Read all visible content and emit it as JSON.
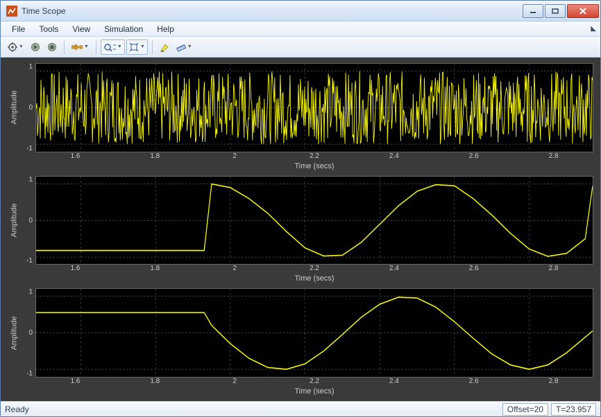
{
  "window": {
    "title": "Time Scope"
  },
  "menu": {
    "items": [
      "File",
      "Tools",
      "View",
      "Simulation",
      "Help"
    ]
  },
  "toolbar": {
    "icons": [
      "gear-icon",
      "play-icon",
      "stop-icon",
      "step-icon",
      "zoom-icon",
      "fit-icon",
      "highlight-icon",
      "measure-icon"
    ]
  },
  "status": {
    "ready": "Ready",
    "offset": "Offset=20",
    "time": "T=23.957"
  },
  "axes": {
    "x_ticks": [
      "1.6",
      "1.8",
      "2",
      "2.2",
      "2.4",
      "2.6",
      "2.8"
    ],
    "y_ticks": [
      "1",
      "0",
      "-1"
    ],
    "xlabel": "Time (secs)",
    "ylabel": "Amplitude"
  },
  "chart_data": [
    {
      "type": "line",
      "title": "",
      "ylabel": "Amplitude",
      "xlabel": "Time (secs)",
      "xlim": [
        1.48,
        2.97
      ],
      "ylim": [
        -1.2,
        1.2
      ],
      "description": "yellow random noise filling full amplitude range (-1..1) across entire visible time window",
      "series": [
        {
          "name": "noise",
          "note": "dense random samples uniform in [-1,1]"
        }
      ]
    },
    {
      "type": "line",
      "title": "",
      "ylabel": "Amplitude",
      "xlabel": "Time (secs)",
      "xlim": [
        1.48,
        2.97
      ],
      "ylim": [
        -1.2,
        1.2
      ],
      "series": [
        {
          "name": "cos-start-1.93",
          "x": [
            1.48,
            1.93,
            1.95,
            2.0,
            2.05,
            2.1,
            2.15,
            2.2,
            2.25,
            2.3,
            2.35,
            2.4,
            2.45,
            2.5,
            2.55,
            2.6,
            2.65,
            2.7,
            2.75,
            2.8,
            2.85,
            2.9,
            2.95,
            2.97
          ],
          "y": [
            -0.82,
            -0.82,
            1.0,
            0.9,
            0.6,
            0.2,
            -0.3,
            -0.75,
            -0.97,
            -0.95,
            -0.6,
            -0.1,
            0.4,
            0.8,
            0.98,
            0.95,
            0.6,
            0.15,
            -0.35,
            -0.78,
            -0.98,
            -0.9,
            -0.5,
            0.95
          ]
        }
      ]
    },
    {
      "type": "line",
      "title": "",
      "ylabel": "Amplitude",
      "xlabel": "Time (secs)",
      "xlim": [
        1.48,
        2.97
      ],
      "ylim": [
        -1.2,
        1.2
      ],
      "series": [
        {
          "name": "sin-start-1.93",
          "x": [
            1.48,
            1.93,
            1.95,
            2.0,
            2.05,
            2.1,
            2.15,
            2.2,
            2.25,
            2.3,
            2.35,
            2.4,
            2.45,
            2.5,
            2.55,
            2.6,
            2.65,
            2.7,
            2.75,
            2.8,
            2.85,
            2.9,
            2.95,
            2.97
          ],
          "y": [
            0.55,
            0.55,
            0.2,
            -0.3,
            -0.7,
            -0.95,
            -1.0,
            -0.85,
            -0.5,
            -0.05,
            0.42,
            0.78,
            0.97,
            0.95,
            0.7,
            0.3,
            -0.15,
            -0.58,
            -0.88,
            -1.0,
            -0.88,
            -0.55,
            -0.12,
            0.05
          ]
        }
      ]
    }
  ]
}
